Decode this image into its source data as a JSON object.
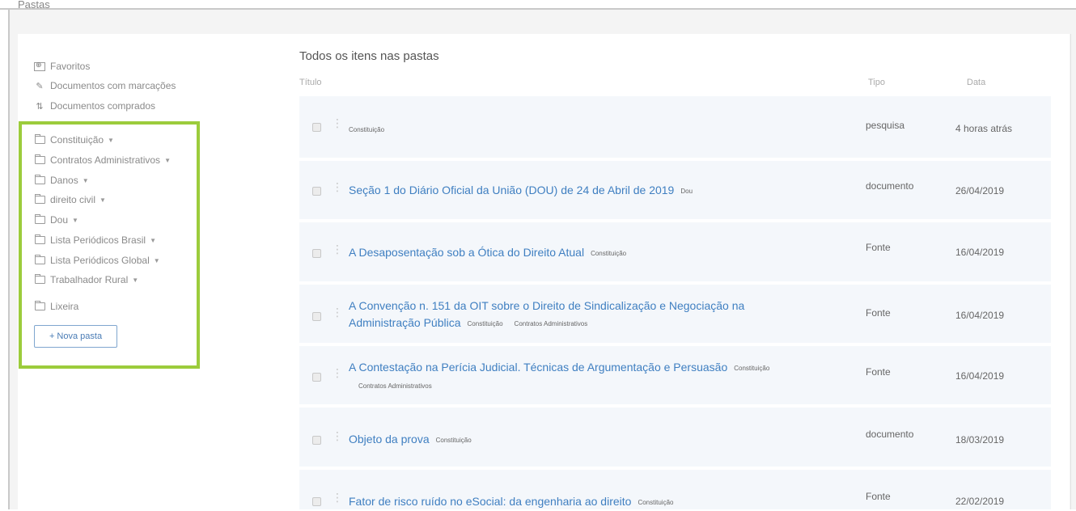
{
  "header": {
    "title": "Pastas"
  },
  "sidebar": {
    "links": [
      {
        "label": "Favoritos",
        "icon": "favorites-icon"
      },
      {
        "label": "Documentos com marcações",
        "icon": "pencil-icon"
      },
      {
        "label": "Documentos comprados",
        "icon": "purchased-icon"
      }
    ],
    "folders": [
      {
        "label": "Constituição"
      },
      {
        "label": "Contratos Administrativos"
      },
      {
        "label": "Danos"
      },
      {
        "label": "direito civil"
      },
      {
        "label": "Dou"
      },
      {
        "label": "Lista Periódicos Brasil"
      },
      {
        "label": "Lista Periódicos Global"
      },
      {
        "label": "Trabalhador Rural"
      }
    ],
    "trash_label": "Lixeira",
    "new_folder_label": "+ Nova pasta",
    "highlight_color": "#9ccc3c"
  },
  "main": {
    "title": "Todos os itens nas pastas",
    "columns": {
      "titulo": "Título",
      "tipo": "Tipo",
      "data": "Data"
    },
    "rows": [
      {
        "title": "",
        "tags": [
          "Constituição"
        ],
        "tipo": "pesquisa",
        "data": "4 horas atrás"
      },
      {
        "title": "Seção 1 do Diário Oficial da União (DOU) de 24 de Abril de 2019",
        "tags": [
          "Dou"
        ],
        "tipo": "documento",
        "data": "26/04/2019"
      },
      {
        "title": "A Desaposentação sob a Ótica do Direito Atual",
        "tags": [
          "Constituição"
        ],
        "tipo": "Fonte",
        "data": "16/04/2019"
      },
      {
        "title": "A Convenção n. 151 da OIT sobre o Direito de Sindicalização e Negociação na Administração Pública",
        "tags": [
          "Constituição",
          "Contratos Administrativos"
        ],
        "tipo": "Fonte",
        "data": "16/04/2019"
      },
      {
        "title": "A Contestação na Perícia Judicial. Técnicas de Argumentação e Persuasão",
        "tags": [
          "Constituição",
          "Contratos Administrativos"
        ],
        "tipo": "Fonte",
        "data": "16/04/2019"
      },
      {
        "title": "Objeto da prova",
        "tags": [
          "Constituição"
        ],
        "tipo": "documento",
        "data": "18/03/2019"
      },
      {
        "title": "Fator de risco ruído no eSocial: da engenharia ao direito",
        "tags": [
          "Constituição"
        ],
        "tipo": "Fonte",
        "data": "22/02/2019"
      }
    ]
  },
  "colors": {
    "link": "#3f7fc1",
    "row_bg": "#f4f7fb",
    "canvas_bg": "#f4f4f4"
  }
}
